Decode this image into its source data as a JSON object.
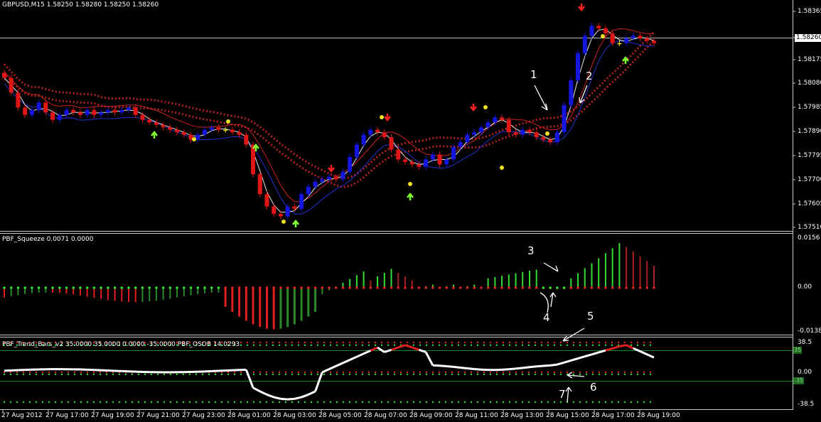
{
  "header": {
    "main_title": "GBPUSD,M15  1.58250 1.58280 1.58250 1.58260",
    "squeeze_title": "PBF_Squeeze 0.0071 0.0000",
    "trend_title": "PBF_Trend_Bars_v2 35.0000 35.0000 0.0000 -35.0000  PBF_OSOB 14.0293"
  },
  "price_axis": {
    "labels": [
      "1.58365",
      "1.58260",
      "1.58175",
      "1.58080",
      "1.57985",
      "1.57890",
      "1.57795",
      "1.57700",
      "1.57605",
      "1.57510"
    ],
    "current": "1.58260"
  },
  "squeeze_axis": {
    "labels": [
      "0.0156",
      "0.00",
      "-0.0138"
    ]
  },
  "trend_axis": {
    "labels": [
      "38.5",
      "0.00",
      "-38.5"
    ],
    "level_box_top": "35",
    "level_box_bottom": "-35"
  },
  "time_axis": {
    "labels": [
      "27 Aug 2012",
      "27 Aug 17:00",
      "27 Aug 19:00",
      "27 Aug 21:00",
      "27 Aug 23:00",
      "28 Aug 01:00",
      "28 Aug 03:00",
      "28 Aug 05:00",
      "28 Aug 07:00",
      "28 Aug 09:00",
      "28 Aug 11:00",
      "28 Aug 13:00",
      "28 Aug 15:00",
      "28 Aug 17:00",
      "28 Aug 19:00"
    ]
  },
  "annotations": [
    "1",
    "2",
    "3",
    "4",
    "5",
    "6",
    "7"
  ],
  "colors": {
    "bull_candle": "#1515e0",
    "bear_candle": "#e01515",
    "neutral_candle": "#f0e020",
    "squeeze_up": "#33dd33",
    "squeeze_down": "#e02020",
    "trend_line": "#ffffff",
    "trend_hot": "#e02020"
  },
  "chart_data": {
    "type": "candlestick",
    "symbol": "GBPUSD",
    "timeframe": "M15",
    "ylim": [
      1.5751,
      1.584
    ],
    "closes": [
      1.5812,
      1.5806,
      1.58,
      1.5797,
      1.5799,
      1.5802,
      1.5798,
      1.5795,
      1.5797,
      1.5799,
      1.5798,
      1.5797,
      1.5799,
      1.5797,
      1.5798,
      1.5799,
      1.5798,
      1.5799,
      1.58,
      1.5797,
      1.5795,
      1.5794,
      1.5793,
      1.5792,
      1.5791,
      1.579,
      1.5789,
      1.5787,
      1.5789,
      1.5791,
      1.5792,
      1.5791,
      1.5791,
      1.579,
      1.5789,
      1.5785,
      1.5773,
      1.5765,
      1.576,
      1.5757,
      1.5756,
      1.576,
      1.5759,
      1.5765,
      1.5768,
      1.577,
      1.5771,
      1.5772,
      1.5771,
      1.5774,
      1.578,
      1.5785,
      1.5789,
      1.5791,
      1.579,
      1.5788,
      1.5783,
      1.5779,
      1.5778,
      1.5777,
      1.5776,
      1.5779,
      1.5781,
      1.5777,
      1.5779,
      1.5784,
      1.5786,
      1.5789,
      1.579,
      1.5792,
      1.5794,
      1.5796,
      1.5795,
      1.579,
      1.5789,
      1.5791,
      1.579,
      1.5788,
      1.5787,
      1.5786,
      1.579,
      1.5801,
      1.5811,
      1.5822,
      1.5829,
      1.5833,
      1.5832,
      1.583,
      1.5826,
      1.5826,
      1.5828,
      1.5829,
      1.5828,
      1.5827,
      1.5826
    ]
  }
}
